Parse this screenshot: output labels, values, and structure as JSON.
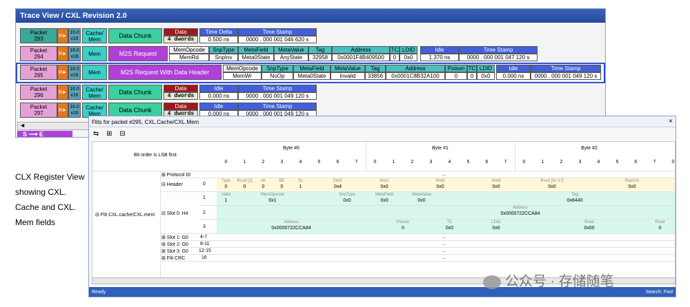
{
  "trace_view": {
    "title": "Trace View / CXL Revision 2.0",
    "scroll_arrow": "◄",
    "direction_label": "S ⟶ E",
    "rows": [
      {
        "packet_label": "Packet",
        "packet_no": "293",
        "r": "R►",
        "link_top": "16.0",
        "link_bot": "x16",
        "type": "Cache/ Mem",
        "chunk": "Data Chunk",
        "h1": "Data",
        "v1": "4 dwords",
        "h2": "Time Delta",
        "v2": "0.500 ns",
        "h3": "Time Stamp",
        "v3": "0000 . 000 001 046 620 s"
      },
      {
        "packet_label": "Packet",
        "packet_no": "294",
        "r": "R►",
        "link_top": "16.0",
        "link_bot": "x16",
        "type": "Mem",
        "chunk": "M2S Request",
        "fields": [
          {
            "h": "MemOpcode",
            "v": "MemRd"
          },
          {
            "h": "SnpType",
            "v": "SnpInv"
          },
          {
            "h": "MetaField",
            "v": "Meta0State"
          },
          {
            "h": "MetaValue",
            "v": "AnyState"
          },
          {
            "h": "Tag",
            "v": "32958"
          },
          {
            "h": "Address",
            "v": "0x0001F4B409500"
          },
          {
            "h": "TC",
            "v": "0"
          },
          {
            "h": "LDID",
            "v": "0x0"
          },
          {
            "h": "Idle",
            "v": "1.370 ns"
          },
          {
            "h": "Time Stamp",
            "v": "0000 . 000 001 047 120 s"
          }
        ]
      },
      {
        "packet_label": "Packet",
        "packet_no": "295",
        "r": "R►",
        "link_top": "16.0",
        "link_bot": "x16",
        "type": "Mem",
        "chunk": "M2S Request With Data Header",
        "fields": [
          {
            "h": "MemOpcode",
            "v": "MemWr"
          },
          {
            "h": "SnpType",
            "v": "NoOp"
          },
          {
            "h": "MetaField",
            "v": "Meta0State"
          },
          {
            "h": "MetaValue",
            "v": "Invalid"
          },
          {
            "h": "Tag",
            "v": "33856"
          },
          {
            "h": "Address",
            "v": "0x0001C8B32A100"
          },
          {
            "h": "Poison",
            "v": "0"
          },
          {
            "h": "TC",
            "v": "0"
          },
          {
            "h": "LDID",
            "v": "0x0"
          },
          {
            "h": "Idle",
            "v": "0.000 ns"
          },
          {
            "h": "Time Stamp",
            "v": "0000 . 000 001 049 120 s"
          }
        ]
      },
      {
        "packet_label": "Packet",
        "packet_no": "296",
        "r": "R►",
        "link_top": "16.0",
        "link_bot": "x16",
        "type": "Cache/ Mem",
        "chunk": "Data Chunk",
        "h1": "Data",
        "v1": "4 dwords",
        "h2": "Idle",
        "v2": "0.000 ns",
        "h3": "Time Stamp",
        "v3": "0000 . 000 001 049 120 s"
      },
      {
        "packet_label": "Packet",
        "packet_no": "297",
        "r": "R►",
        "link_top": "16.0",
        "link_bot": "x16",
        "type": "Cache/ Mem",
        "chunk": "Data Chunk",
        "h1": "Data",
        "v1": "4 dwords",
        "h2": "Idle",
        "v2": "0.000 ns",
        "h3": "Time Stamp",
        "v3": "0000 . 000 001 049 120 s"
      }
    ]
  },
  "caption": [
    "CLX Register View",
    "showing CXL.",
    "Cache and CXL.",
    "Mem fields"
  ],
  "flits_window": {
    "title": "Flits for packet #295, CXL.Cache/CXL.Mem",
    "close": "×",
    "tools": [
      "⇆",
      "⊞",
      "⊟"
    ],
    "bit_order": "Bit order is LSB first",
    "bytes": [
      "Byte #0",
      "Byte #1",
      "Byte #2"
    ],
    "bits": [
      "0",
      "1",
      "2",
      "3",
      "4",
      "5",
      "6",
      "7",
      "0",
      "1",
      "2",
      "3",
      "4",
      "5",
      "6",
      "7",
      "0",
      "1",
      "2",
      "3",
      "4",
      "5",
      "6",
      "7",
      "0"
    ],
    "flit_label": "⊟ Flit CXL.cache/CXL.mem",
    "rows": [
      {
        "name": "⊞ Protocol ID",
        "idx": "",
        "value": "..."
      },
      {
        "name": "⊟ Header",
        "idx": "0"
      },
      {
        "name": "",
        "idx": "1"
      },
      {
        "name": "⊟ Slot 0: H4",
        "idx": "2"
      },
      {
        "name": "",
        "idx": "3"
      },
      {
        "name": "⊞ Slot 1: G0",
        "idx": "4-7",
        "value": "..."
      },
      {
        "name": "⊞ Slot 2: G0",
        "idx": "8-11",
        "value": "..."
      },
      {
        "name": "⊞ Slot 3: G0",
        "idx": "12-15",
        "value": "..."
      },
      {
        "name": "⊞ Flit CRC",
        "idx": "16",
        "value": "..."
      }
    ],
    "header_fields": [
      {
        "l": "Type",
        "v": "0"
      },
      {
        "l": "Rsvd [1]",
        "v": "0"
      },
      {
        "l": "Ak",
        "v": "0"
      },
      {
        "l": "BE",
        "v": "0"
      },
      {
        "l": "Sz",
        "v": "1"
      },
      {
        "l": "Slot0",
        "v": "0x4"
      },
      {
        "l": "Slot1",
        "v": "0x0"
      },
      {
        "l": "Slot2",
        "v": "0x0"
      },
      {
        "l": "Slot3",
        "v": "0x0"
      },
      {
        "l": "Rsvd [0x 17]",
        "v": "0x0"
      },
      {
        "l": "RspCrd",
        "v": "0x0"
      }
    ],
    "slot0_row1": [
      {
        "l": "Valid",
        "v": "1"
      },
      {
        "l": "MemOpcode",
        "v": "0x1"
      },
      {
        "l": "SnpType",
        "v": "0x0"
      },
      {
        "l": "MetaField",
        "v": "0x0"
      },
      {
        "l": "MetaValue",
        "v": "0x0"
      },
      {
        "l": "Tag",
        "v": "0x8440"
      }
    ],
    "slot0_row2": {
      "l": "Address",
      "v": "0x0000722CCA84"
    },
    "slot0_row3": [
      {
        "l": "Address",
        "v": "0x0000722CCA84"
      },
      {
        "l": "Poison",
        "v": "0"
      },
      {
        "l": "TC",
        "v": "0x0"
      },
      {
        "l": "LDID",
        "v": "0x0"
      },
      {
        "l": "Rsvd",
        "v": "0x00"
      },
      {
        "l": "Rsvd",
        "v": "0"
      }
    ],
    "status_left": "Ready",
    "status_right": "Search: Fwd"
  },
  "watermark": "公众号 · 存储随笔"
}
